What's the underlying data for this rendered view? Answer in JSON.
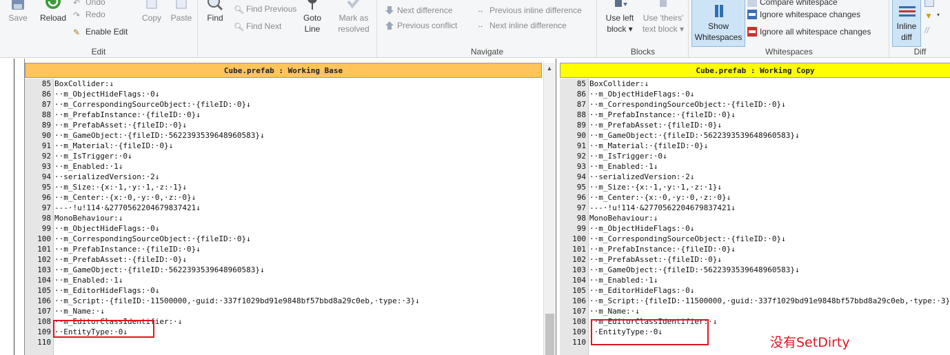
{
  "ribbon": {
    "edit": {
      "label": "Edit",
      "save": "Save",
      "reload": "Reload",
      "undo": "Undo",
      "redo": "Redo",
      "enable_edit": "Enable Edit",
      "copy": "Copy",
      "paste": "Paste",
      "find": "Find",
      "find_previous": "Find Previous",
      "find_next": "Find Next",
      "goto_line_1": "Goto",
      "goto_line_2": "Line",
      "mark_resolved_1": "Mark as",
      "mark_resolved_2": "resolved"
    },
    "navigate": {
      "label": "Navigate",
      "next_difference": "Next difference",
      "previous_conflict": "Previous conflict",
      "previous_inline_difference": "Previous inline difference",
      "next_inline_difference": "Next inline difference"
    },
    "blocks": {
      "label": "Blocks",
      "use_left_1": "Use left",
      "use_left_2": "block",
      "use_theirs_1": "Use 'theirs'",
      "use_theirs_2": "text block"
    },
    "whitespaces": {
      "label": "Whitespaces",
      "show_1": "Show",
      "show_2": "Whitespaces",
      "compare_whitespace": "Compare whitespace",
      "ignore_whitespace_changes": "Ignore whitespace changes",
      "ignore_all_whitespace_changes": "Ignore all whitespace changes"
    },
    "diff": {
      "label": "Diff",
      "inline_1": "Inline",
      "inline_2": "diff"
    }
  },
  "left_pane": {
    "title": "Cube.prefab : Working Base",
    "header_color": "#ffc45c"
  },
  "right_pane": {
    "title": "Cube.prefab : Working Copy",
    "header_color": "#ffff00"
  },
  "lines": [
    {
      "n": "85",
      "left": "BoxCollider:↓",
      "right": "BoxCollider:↓"
    },
    {
      "n": "86",
      "left": "··m_ObjectHideFlags:·0↓",
      "right": "··m_ObjectHideFlags:·0↓"
    },
    {
      "n": "87",
      "left": "··m_CorrespondingSourceObject:·{fileID:·0}↓",
      "right": "··m_CorrespondingSourceObject:·{fileID:·0}↓"
    },
    {
      "n": "88",
      "left": "··m_PrefabInstance:·{fileID:·0}↓",
      "right": "··m_PrefabInstance:·{fileID:·0}↓"
    },
    {
      "n": "89",
      "left": "··m_PrefabAsset:·{fileID:·0}↓",
      "right": "··m_PrefabAsset:·{fileID:·0}↓"
    },
    {
      "n": "90",
      "left": "··m_GameObject:·{fileID:·5622393539648960583}↓",
      "right": "··m_GameObject:·{fileID:·5622393539648960583}↓"
    },
    {
      "n": "91",
      "left": "··m_Material:·{fileID:·0}↓",
      "right": "··m_Material:·{fileID:·0}↓"
    },
    {
      "n": "92",
      "left": "··m_IsTrigger:·0↓",
      "right": "··m_IsTrigger:·0↓"
    },
    {
      "n": "93",
      "left": "··m_Enabled:·1↓",
      "right": "··m_Enabled:·1↓"
    },
    {
      "n": "94",
      "left": "··serializedVersion:·2↓",
      "right": "··serializedVersion:·2↓"
    },
    {
      "n": "95",
      "left": "··m_Size:·{x:·1,·y:·1,·z:·1}↓",
      "right": "··m_Size:·{x:·1,·y:·1,·z:·1}↓"
    },
    {
      "n": "96",
      "left": "··m_Center:·{x:·0,·y:·0,·z:·0}↓",
      "right": "··m_Center:·{x:·0,·y:·0,·z:·0}↓"
    },
    {
      "n": "97",
      "left": "---·!u!114·&2770562204679837421↓",
      "right": "---·!u!114·&2770562204679837421↓"
    },
    {
      "n": "98",
      "left": "MonoBehaviour:↓",
      "right": "MonoBehaviour:↓"
    },
    {
      "n": "99",
      "left": "··m_ObjectHideFlags:·0↓",
      "right": "··m_ObjectHideFlags:·0↓"
    },
    {
      "n": "100",
      "left": "··m_CorrespondingSourceObject:·{fileID:·0}↓",
      "right": "··m_CorrespondingSourceObject:·{fileID:·0}↓"
    },
    {
      "n": "101",
      "left": "··m_PrefabInstance:·{fileID:·0}↓",
      "right": "··m_PrefabInstance:·{fileID:·0}↓"
    },
    {
      "n": "102",
      "left": "··m_PrefabAsset:·{fileID:·0}↓",
      "right": "··m_PrefabAsset:·{fileID:·0}↓"
    },
    {
      "n": "103",
      "left": "··m_GameObject:·{fileID:·5622393539648960583}↓",
      "right": "··m_GameObject:·{fileID:·5622393539648960583}↓"
    },
    {
      "n": "104",
      "left": "··m_Enabled:·1↓",
      "right": "··m_Enabled:·1↓"
    },
    {
      "n": "105",
      "left": "··m_EditorHideFlags:·0↓",
      "right": "··m_EditorHideFlags:·0↓"
    },
    {
      "n": "106",
      "left": "··m_Script:·{fileID:·11500000,·guid:·337f1029bd91e9848bf57bbd8a29c0eb,·type:·3}↓",
      "right": "··m_Script:·{fileID:·11500000,·guid:·337f1029bd91e9848bf57bbd8a29c0eb,·type:·3}↓"
    },
    {
      "n": "107",
      "left": "··m_Name:·↓",
      "right": "··m_Name:·↓"
    },
    {
      "n": "108",
      "left": "··m_EditorClassIdentifier:·↓",
      "right": "··m_EditorClassIdentifier:·↓"
    },
    {
      "n": "109",
      "left": "··EntityType:·0↓",
      "right": "··EntityType:·0↓"
    },
    {
      "n": "110",
      "left": "",
      "right": ""
    }
  ],
  "annotation": "没有SetDirty",
  "colors": {
    "ribbon_bg": "#f5f6f7",
    "gutter_bg": "#e6e6e6",
    "highlight_box": "#e0141e",
    "active_button": "#cde4f7"
  }
}
